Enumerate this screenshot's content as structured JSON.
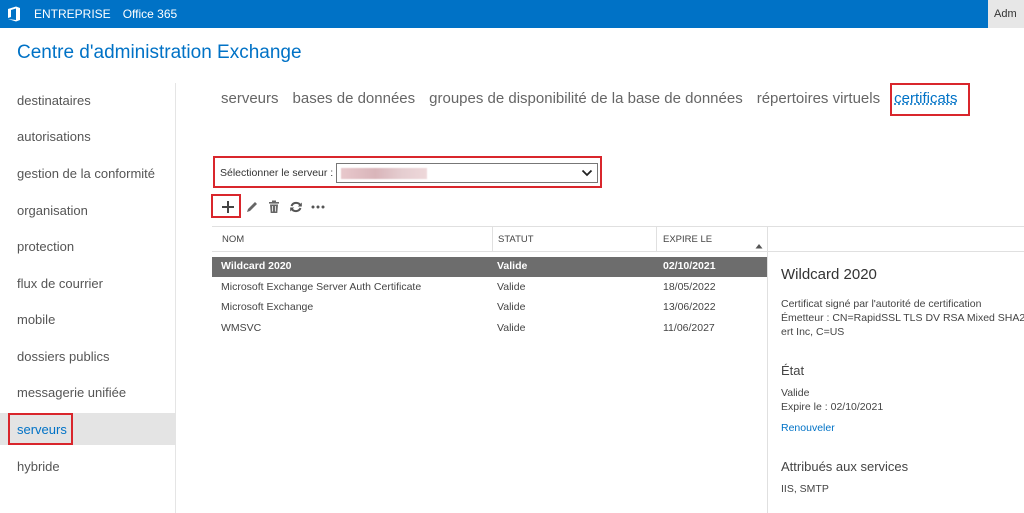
{
  "topbar": {
    "logo_icon": "office-logo-icon",
    "links": [
      "ENTREPRISE",
      "Office 365"
    ],
    "user": "Adm"
  },
  "app_title": "Centre d'administration Exchange",
  "leftnav": {
    "items": [
      "destinataires",
      "autorisations",
      "gestion de la conformité",
      "organisation",
      "protection",
      "flux de courrier",
      "mobile",
      "dossiers publics",
      "messagerie unifiée",
      "serveurs",
      "hybride"
    ],
    "active": "serveurs"
  },
  "tabs": {
    "items": [
      "serveurs",
      "bases de données",
      "groupes de disponibilité de la base de données",
      "répertoires virtuels",
      "certificats"
    ],
    "active": "certificats"
  },
  "server_select": {
    "label": "Sélectionner le serveur :"
  },
  "toolbar": {
    "icons": [
      "add-icon",
      "edit-icon",
      "delete-icon",
      "refresh-icon",
      "more-icon"
    ]
  },
  "table": {
    "columns": [
      "NOM",
      "STATUT",
      "EXPIRE LE"
    ],
    "rows": [
      {
        "name": "Wildcard 2020",
        "status": "Valide",
        "expires": "02/10/2021"
      },
      {
        "name": "Microsoft Exchange Server Auth Certificate",
        "status": "Valide",
        "expires": "18/05/2022"
      },
      {
        "name": "Microsoft Exchange",
        "status": "Valide",
        "expires": "13/06/2022"
      },
      {
        "name": "WMSVC",
        "status": "Valide",
        "expires": "11/06/2027"
      }
    ],
    "selected_row": 0
  },
  "details": {
    "title": "Wildcard 2020",
    "signed_by": "Certificat signé par l'autorité de certification",
    "issuer_line1": "Émetteur : CN=RapidSSL TLS DV RSA Mixed SHA256",
    "issuer_line2": "ert Inc, C=US",
    "state_heading": "État",
    "state_value": "Valide",
    "expire_text": "Expire le : 02/10/2021",
    "renew_link": "Renouveler",
    "services_heading": "Attribués aux services",
    "services_value": "IIS, SMTP"
  },
  "colors": {
    "brand": "#0072c6",
    "highlight_box": "#d9262c",
    "selected_row": "#6d6d6d"
  }
}
